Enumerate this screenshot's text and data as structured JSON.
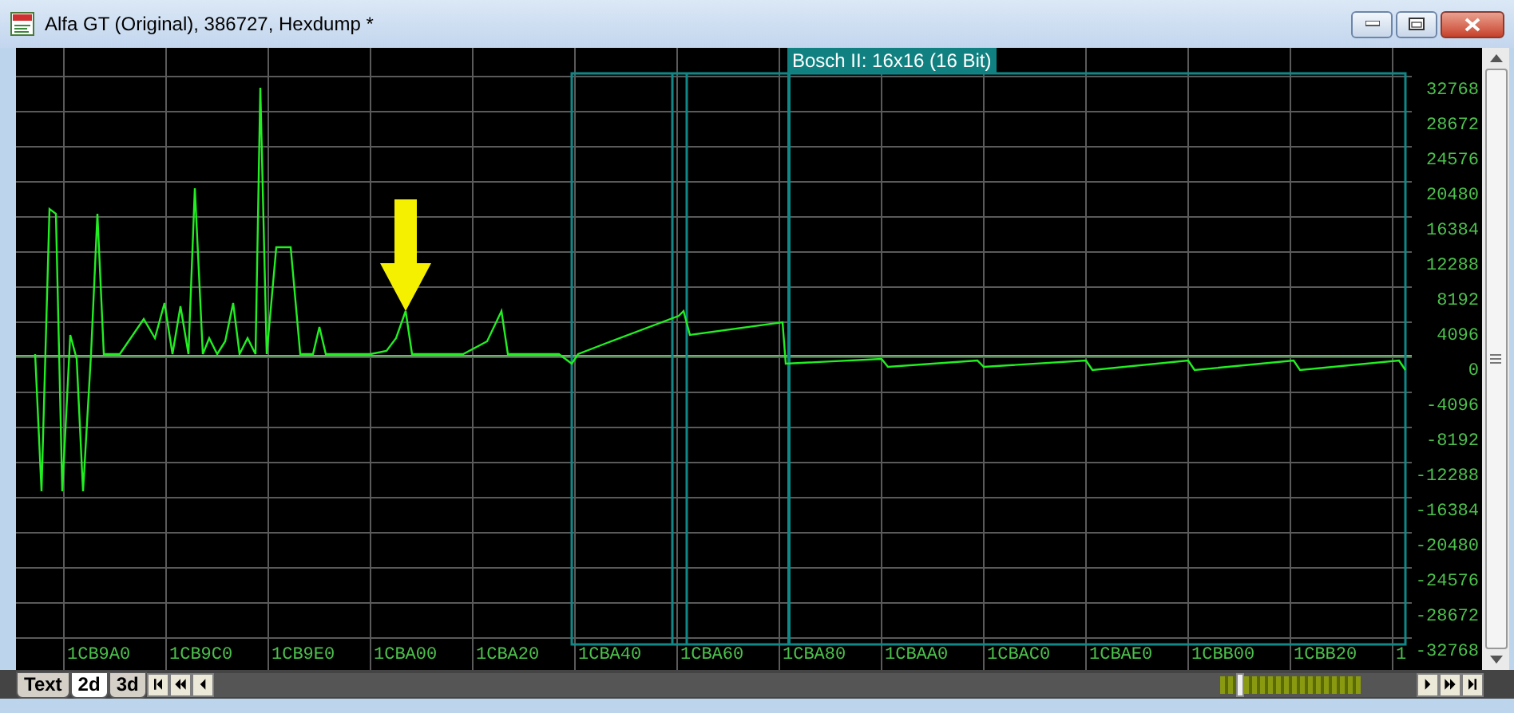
{
  "window": {
    "title": "Alfa GT (Original), 386727, Hexdump *"
  },
  "plot": {
    "map_label": "Bosch II: 16x16 (16 Bit)",
    "y_labels": [
      "32768",
      "28672",
      "24576",
      "20480",
      "16384",
      "12288",
      "8192",
      "4096",
      "0",
      "-4096",
      "-8192",
      "-12288",
      "-16384",
      "-20480",
      "-24576",
      "-28672",
      "-32768"
    ],
    "x_labels": [
      "1CB9A0",
      "1CB9C0",
      "1CB9E0",
      "1CBA00",
      "1CBA20",
      "1CBA40",
      "1CBA60",
      "1CBA80",
      "1CBAA0",
      "1CBAC0",
      "1CBAE0",
      "1CBB00",
      "1CBB20",
      "1"
    ]
  },
  "tabs": [
    {
      "label": "Text",
      "selected": false
    },
    {
      "label": "2d",
      "selected": true
    },
    {
      "label": "3d",
      "selected": false
    }
  ]
}
